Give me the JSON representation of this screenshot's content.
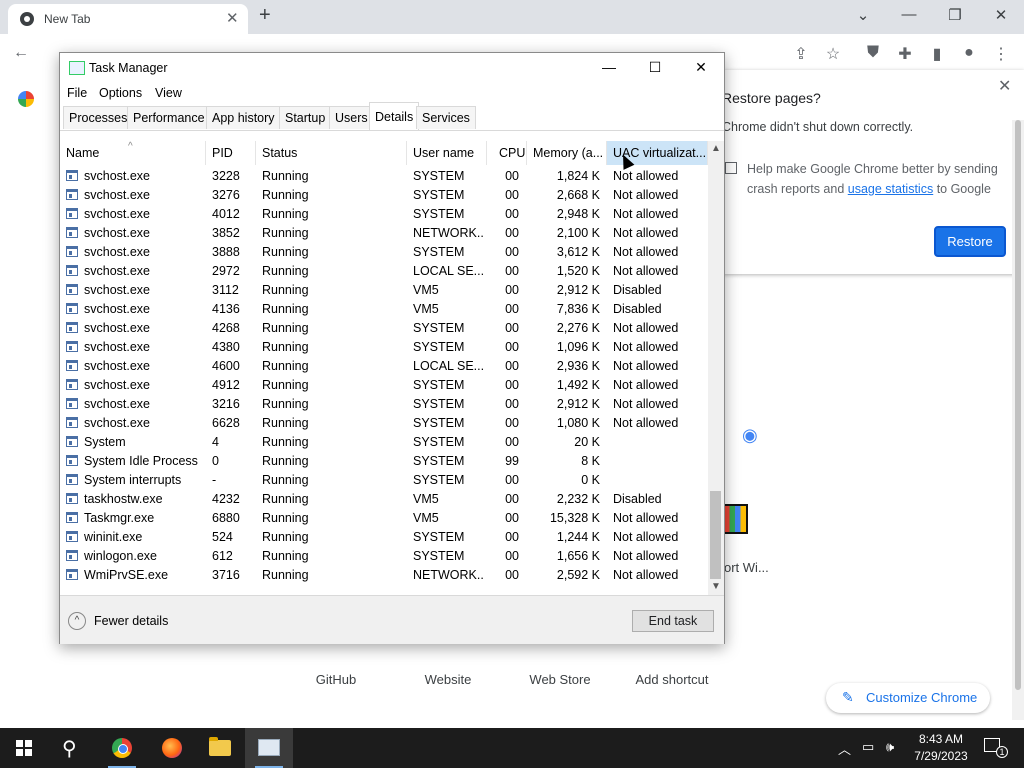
{
  "chrome": {
    "tab_title": "New Tab",
    "window_controls": {
      "dropdown": "⌄",
      "minimize": "—",
      "maximize": "❐",
      "close": "✕"
    },
    "restore_popup": {
      "title": "Restore pages?",
      "message": "Chrome didn't shut down correctly.",
      "help_text_before": "Help make Google Chrome better by sending crash reports and ",
      "help_link": "usage statistics",
      "help_text_after": " to Google",
      "restore_button": "Restore",
      "close": "✕"
    },
    "shortcuts": [
      "GitHub",
      "Website",
      "Web Store",
      "Add shortcut"
    ],
    "shortcut_fragment": "ort Wi...",
    "customize_button": "Customize Chrome"
  },
  "task_manager": {
    "title": "Task Manager",
    "controls": {
      "minimize": "—",
      "maximize": "☐",
      "close": "✕"
    },
    "menu": [
      "File",
      "Options",
      "View"
    ],
    "tabs": [
      "Processes",
      "Performance",
      "App history",
      "Startup",
      "Users",
      "Details",
      "Services"
    ],
    "active_tab": "Details",
    "columns": [
      "Name",
      "PID",
      "Status",
      "User name",
      "CPU",
      "Memory (a...",
      "UAC virtualizat..."
    ],
    "rows": [
      {
        "name": "svchost.exe",
        "pid": "3228",
        "status": "Running",
        "user": "SYSTEM",
        "cpu": "00",
        "memory": "1,824 K",
        "uac": "Not allowed"
      },
      {
        "name": "svchost.exe",
        "pid": "3276",
        "status": "Running",
        "user": "SYSTEM",
        "cpu": "00",
        "memory": "2,668 K",
        "uac": "Not allowed"
      },
      {
        "name": "svchost.exe",
        "pid": "4012",
        "status": "Running",
        "user": "SYSTEM",
        "cpu": "00",
        "memory": "2,948 K",
        "uac": "Not allowed"
      },
      {
        "name": "svchost.exe",
        "pid": "3852",
        "status": "Running",
        "user": "NETWORK...",
        "cpu": "00",
        "memory": "2,100 K",
        "uac": "Not allowed"
      },
      {
        "name": "svchost.exe",
        "pid": "3888",
        "status": "Running",
        "user": "SYSTEM",
        "cpu": "00",
        "memory": "3,612 K",
        "uac": "Not allowed"
      },
      {
        "name": "svchost.exe",
        "pid": "2972",
        "status": "Running",
        "user": "LOCAL SE...",
        "cpu": "00",
        "memory": "1,520 K",
        "uac": "Not allowed"
      },
      {
        "name": "svchost.exe",
        "pid": "3112",
        "status": "Running",
        "user": "VM5",
        "cpu": "00",
        "memory": "2,912 K",
        "uac": "Disabled"
      },
      {
        "name": "svchost.exe",
        "pid": "4136",
        "status": "Running",
        "user": "VM5",
        "cpu": "00",
        "memory": "7,836 K",
        "uac": "Disabled"
      },
      {
        "name": "svchost.exe",
        "pid": "4268",
        "status": "Running",
        "user": "SYSTEM",
        "cpu": "00",
        "memory": "2,276 K",
        "uac": "Not allowed"
      },
      {
        "name": "svchost.exe",
        "pid": "4380",
        "status": "Running",
        "user": "SYSTEM",
        "cpu": "00",
        "memory": "1,096 K",
        "uac": "Not allowed"
      },
      {
        "name": "svchost.exe",
        "pid": "4600",
        "status": "Running",
        "user": "LOCAL SE...",
        "cpu": "00",
        "memory": "2,936 K",
        "uac": "Not allowed"
      },
      {
        "name": "svchost.exe",
        "pid": "4912",
        "status": "Running",
        "user": "SYSTEM",
        "cpu": "00",
        "memory": "1,492 K",
        "uac": "Not allowed"
      },
      {
        "name": "svchost.exe",
        "pid": "3216",
        "status": "Running",
        "user": "SYSTEM",
        "cpu": "00",
        "memory": "2,912 K",
        "uac": "Not allowed"
      },
      {
        "name": "svchost.exe",
        "pid": "6628",
        "status": "Running",
        "user": "SYSTEM",
        "cpu": "00",
        "memory": "1,080 K",
        "uac": "Not allowed"
      },
      {
        "name": "System",
        "pid": "4",
        "status": "Running",
        "user": "SYSTEM",
        "cpu": "00",
        "memory": "20 K",
        "uac": ""
      },
      {
        "name": "System Idle Process",
        "pid": "0",
        "status": "Running",
        "user": "SYSTEM",
        "cpu": "99",
        "memory": "8 K",
        "uac": ""
      },
      {
        "name": "System interrupts",
        "pid": "-",
        "status": "Running",
        "user": "SYSTEM",
        "cpu": "00",
        "memory": "0 K",
        "uac": ""
      },
      {
        "name": "taskhostw.exe",
        "pid": "4232",
        "status": "Running",
        "user": "VM5",
        "cpu": "00",
        "memory": "2,232 K",
        "uac": "Disabled"
      },
      {
        "name": "Taskmgr.exe",
        "pid": "6880",
        "status": "Running",
        "user": "VM5",
        "cpu": "00",
        "memory": "15,328 K",
        "uac": "Not allowed"
      },
      {
        "name": "wininit.exe",
        "pid": "524",
        "status": "Running",
        "user": "SYSTEM",
        "cpu": "00",
        "memory": "1,244 K",
        "uac": "Not allowed"
      },
      {
        "name": "winlogon.exe",
        "pid": "612",
        "status": "Running",
        "user": "SYSTEM",
        "cpu": "00",
        "memory": "1,656 K",
        "uac": "Not allowed"
      },
      {
        "name": "WmiPrvSE.exe",
        "pid": "3716",
        "status": "Running",
        "user": "NETWORK...",
        "cpu": "00",
        "memory": "2,592 K",
        "uac": "Not allowed"
      }
    ],
    "fewer_details": "Fewer details",
    "end_task": "End task"
  },
  "taskbar": {
    "time": "8:43 AM",
    "date": "7/29/2023",
    "notification_count": "1",
    "icons": [
      "windows-start-icon",
      "search-icon",
      "chrome-icon",
      "firefox-icon",
      "file-explorer-icon",
      "task-manager-icon"
    ]
  }
}
